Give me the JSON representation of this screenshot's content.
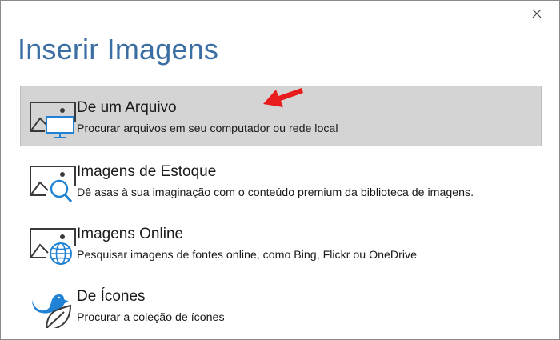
{
  "dialog": {
    "title": "Inserir Imagens",
    "close_icon": "close-icon"
  },
  "options": [
    {
      "title": "De um Arquivo",
      "description": "Procurar arquivos em seu computador ou rede local",
      "icon": "picture-monitor-icon",
      "selected": true
    },
    {
      "title": "Imagens de Estoque",
      "description": "Dê asas à sua imaginação com o conteúdo premium da biblioteca de imagens.",
      "icon": "picture-search-icon",
      "selected": false
    },
    {
      "title": "Imagens Online",
      "description": "Pesquisar imagens de fontes online, como Bing, Flickr ou OneDrive",
      "icon": "picture-globe-icon",
      "selected": false
    },
    {
      "title": "De Ícones",
      "description": "Procurar a coleção de ícones",
      "icon": "bird-leaf-icon",
      "selected": false
    }
  ],
  "annotation": {
    "icon": "red-arrow-icon",
    "color": "#e81c1c"
  },
  "colors": {
    "title": "#3b6fa4",
    "accent_blue": "#1f82d4",
    "selected_bg": "#d4d4d4"
  }
}
